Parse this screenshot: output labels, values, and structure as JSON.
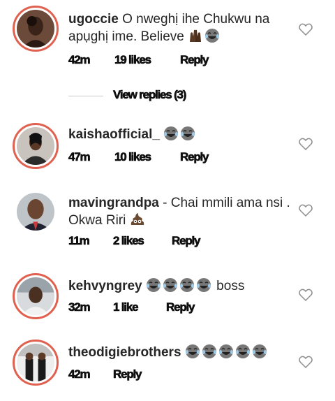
{
  "colors": {
    "story_ring": "#e0614f",
    "text": "#262626",
    "meta": "#111111"
  },
  "comments": [
    {
      "username": "ugoccie",
      "text": " O nweghị ihe Chukwu na apụghị ime. Believe ",
      "emojis": [
        "raised-hands-dark",
        "laughing-crying"
      ],
      "time": "42m",
      "likes": "19 likes",
      "reply": "Reply"
    },
    {
      "username": "kaishaofficial_",
      "text": " ",
      "emojis": [
        "laughing-crying",
        "laughing-crying"
      ],
      "time": "47m",
      "likes": "10 likes",
      "reply": "Reply"
    },
    {
      "username": "mavingrandpa",
      "text": " - Chai mmili ama nsi . Okwa Riri ",
      "emojis": [
        "poo"
      ],
      "time": "11m",
      "likes": "2 likes",
      "reply": "Reply"
    },
    {
      "username": "kehvyngrey",
      "text": " ",
      "emojis": [
        "laughing-crying",
        "laughing-crying",
        "laughing-crying",
        "laughing-crying"
      ],
      "text_after": " boss",
      "time": "32m",
      "likes": "1 like",
      "reply": "Reply"
    },
    {
      "username": "theodigiebrothers",
      "text": " ",
      "emojis": [
        "laughing-crying",
        "laughing-crying",
        "laughing-crying",
        "laughing-crying",
        "laughing-crying"
      ],
      "time": "42m",
      "reply": "Reply"
    }
  ],
  "view_replies": {
    "label": "View replies (3)"
  }
}
